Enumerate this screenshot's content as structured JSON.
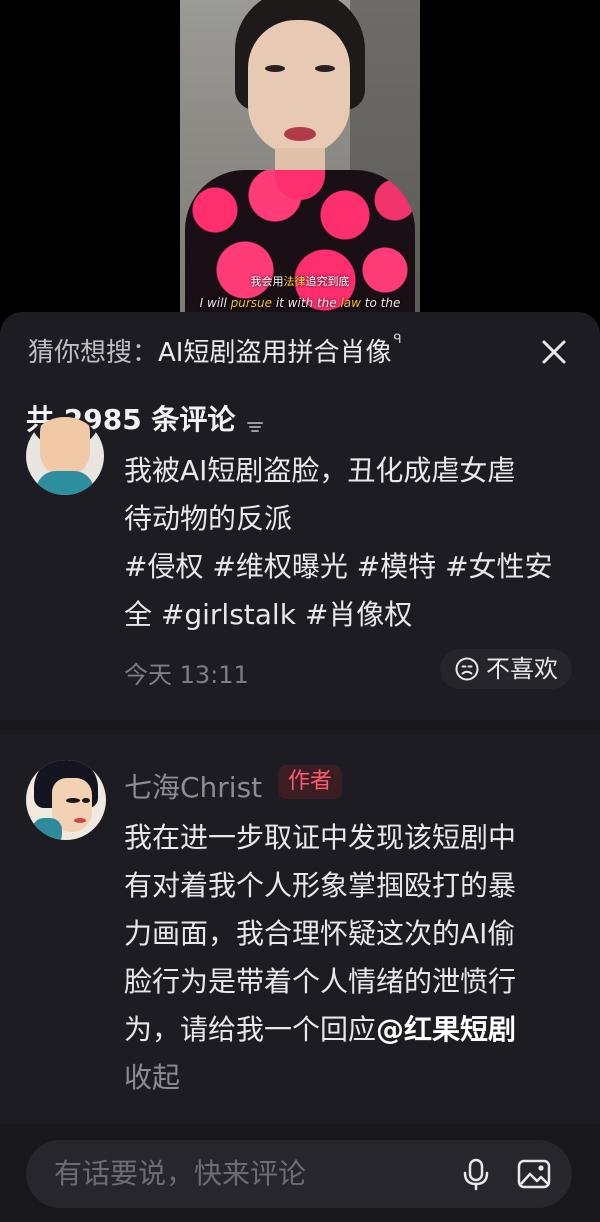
{
  "video": {
    "subtitle_cn_pre": "我会用",
    "subtitle_cn_hl": "法律",
    "subtitle_cn_post": "追究到底",
    "subtitle_en_pre": "I will ",
    "subtitle_en_hl": "pursue",
    "subtitle_en_mid": " it with the ",
    "subtitle_en_hl2": "law",
    "subtitle_en_post": " to the"
  },
  "suggest": {
    "label": "猜你想搜：",
    "query": "AI短剧盗用拼合肖像",
    "search_glyph": "ᑫ"
  },
  "comments_header": {
    "title": "共 2985 条评论"
  },
  "comments": [
    {
      "lines": [
        "我被AI短剧盗脸，丑化成虐女虐",
        "待动物的反派",
        "#侵权 #维权曝光 #模特 #女性安",
        "全 #girlstalk #肖像权"
      ],
      "time": "今天 13:11",
      "dislike_label": "不喜欢"
    },
    {
      "author": "七海Christ",
      "badge": "作者",
      "lines": [
        "我在进一步取证中发现该短剧中",
        "有对着我个人形象掌掴殴打的暴",
        "力画面，我合理怀疑这次的AI偷",
        "脸行为是带着个人情绪的泄愤行"
      ],
      "last_line_pre": "为，请给我一个回应",
      "mention": "@红果短剧",
      "collapse": "收起"
    }
  ],
  "input": {
    "placeholder": "有话要说，快来评论"
  },
  "icons": {
    "close": "close-icon",
    "filter": "filter-icon",
    "dislike": "frown-face-icon",
    "mic": "microphone-icon",
    "image": "image-icon"
  },
  "colors": {
    "sheet_bg": "#1c1c22",
    "badge_text": "#ff5a6b",
    "subtitle_highlight": "#ffd23a"
  }
}
